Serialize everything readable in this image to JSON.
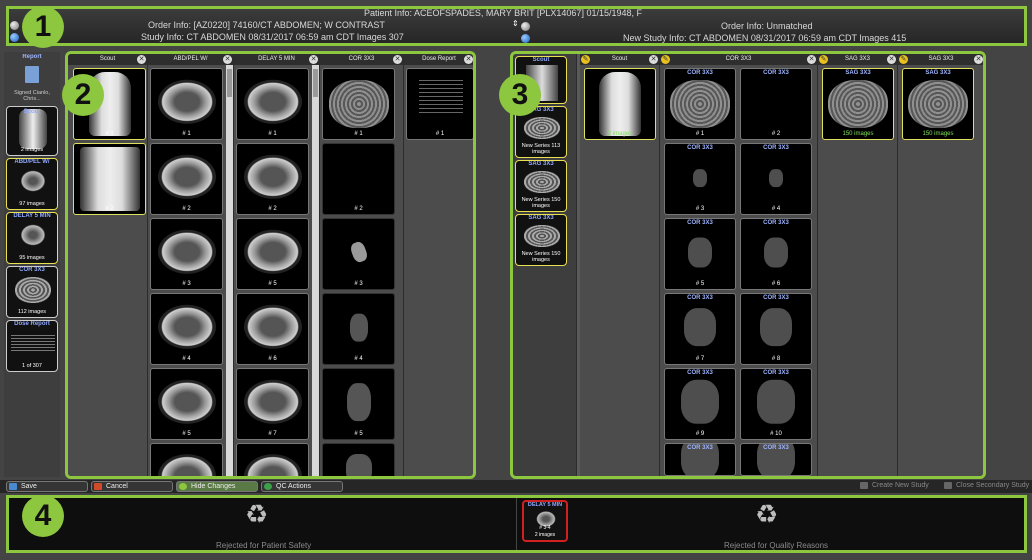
{
  "header": {
    "patient_info": "Patient Info: ACEOFSPADES, MARY BRIT [PLX14067] 01/15/1948, F",
    "left_order": "Order Info: [AZ0220] 74160/CT ABDOMEN; W CONTRAST",
    "left_study": "Study Info: CT ABDOMEN  08/31/2017 06:59 am CDT  Images 307",
    "right_order": "Order Info: Unmatched",
    "right_study": "New Study Info: CT ABDOMEN  08/31/2017 06:59 am CDT  Images 415"
  },
  "badges": [
    "1",
    "2",
    "3",
    "4"
  ],
  "left_thumbs": [
    {
      "label": "Report",
      "sub": "Signed Cianlo, Chris..."
    },
    {
      "label": "Scout",
      "sub": "2 images"
    },
    {
      "label": "ABD/PEL W/",
      "sub": "97 images"
    },
    {
      "label": "DELAY 5 MIN",
      "sub": "95 images"
    },
    {
      "label": "COR 3X3",
      "sub": "112 images"
    },
    {
      "label": "Dose Report",
      "sub": "1 of 307"
    }
  ],
  "left_pane": {
    "columns": [
      {
        "title": "Scout",
        "images": [
          "# 1",
          "# 2"
        ]
      },
      {
        "title": "ABD/PEL W/",
        "images": [
          "# 1",
          "# 2",
          "# 3",
          "# 4",
          "# 5"
        ]
      },
      {
        "title": "DELAY 5 MIN",
        "images": [
          "# 1",
          "# 2",
          "# 5",
          "# 6",
          "# 7"
        ]
      },
      {
        "title": "COR 3X3",
        "images": [
          "# 1",
          "# 2",
          "# 3",
          "# 4",
          "# 5"
        ]
      },
      {
        "title": "Dose Report",
        "images": [
          "# 1"
        ]
      }
    ]
  },
  "right_thumbs": [
    {
      "label": "Scout",
      "sub": ""
    },
    {
      "label": "SAG 3X3",
      "sub": "New Series 113 images"
    },
    {
      "label": "SAG 3X3",
      "sub": "New Series 150 images"
    },
    {
      "label": "SAG 3X3",
      "sub": "New Series 150 images"
    }
  ],
  "right_pane": {
    "columns": [
      {
        "title": "Scout",
        "top_sub": "2 images"
      },
      {
        "title": "COR 3X3",
        "images": [
          {
            "label": "COR 3X3",
            "num": "# 1"
          },
          {
            "label": "COR 3X3",
            "num": "# 2"
          },
          {
            "label": "COR 3X3",
            "num": "# 3"
          },
          {
            "label": "COR 3X3",
            "num": "# 4"
          },
          {
            "label": "COR 3X3",
            "num": "# 5"
          },
          {
            "label": "COR 3X3",
            "num": "# 6"
          },
          {
            "label": "COR 3X3",
            "num": "# 7"
          },
          {
            "label": "COR 3X3",
            "num": "# 8"
          },
          {
            "label": "COR 3X3",
            "num": "# 9"
          },
          {
            "label": "COR 3X3",
            "num": "# 10"
          },
          {
            "label": "COR 3X3",
            "num": ""
          },
          {
            "label": "COR 3X3",
            "num": ""
          }
        ]
      },
      {
        "title": "SAG 3X3",
        "label": "SAG 3X3",
        "sub": "150 images"
      },
      {
        "title": "SAG 3X3",
        "label": "SAG 3X3",
        "sub": "150 images"
      }
    ]
  },
  "toolbar": {
    "save": "Save",
    "cancel": "Cancel",
    "hide_changes": "Hide Changes",
    "qc_actions": "QC Actions",
    "create_new_study": "Create New Study",
    "close_secondary": "Close Secondary Study"
  },
  "bottom": {
    "left_reason": "Rejected for Patient Safety",
    "right_reason": "Rejected for Quality Reasons",
    "rejected_card": {
      "label": "DELAY 5 MIN",
      "num": "# 3-4",
      "sub": "2 images"
    }
  }
}
